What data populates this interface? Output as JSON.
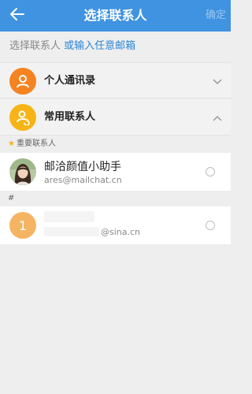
{
  "header": {
    "title": "选择联系人",
    "confirm_label": "确定",
    "back_icon": "arrow-left-icon"
  },
  "prompt": {
    "prefix": "选择联系人",
    "link": "或输入任意邮箱"
  },
  "groups": [
    {
      "label": "个人通讯录",
      "icon": "person-icon",
      "color": "#f58320",
      "expanded": false
    },
    {
      "label": "常用联系人",
      "icon": "person-refresh-icon",
      "color": "#f6b417",
      "expanded": true
    }
  ],
  "sections": {
    "vip": "重要联系人",
    "hash": "#"
  },
  "contacts": [
    {
      "name": "邮洽颜值小助手",
      "email": "ares@mailchat.cn",
      "avatar": "photo"
    },
    {
      "name": "",
      "email": "@sina.cn",
      "avatar_letter": "1"
    }
  ],
  "colors": {
    "header_bg": "#3f93e0",
    "link": "#2a86d8"
  }
}
